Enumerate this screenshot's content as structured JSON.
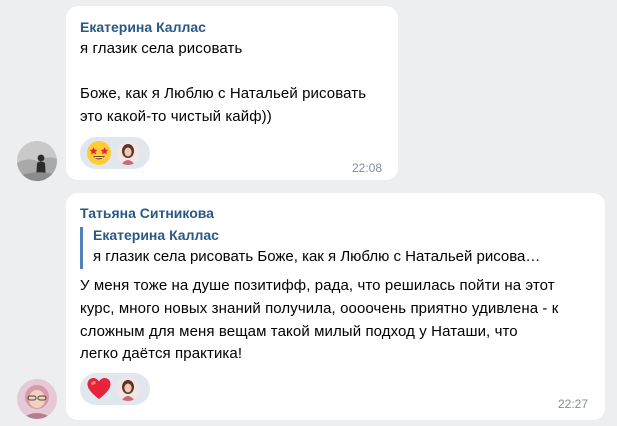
{
  "messages": [
    {
      "author": "Екатерина Каллас",
      "lines": [
        "я глазик села рисовать",
        "",
        "Боже, как я Люблю с Натальей рисовать",
        "это какой-то чистый кайф))"
      ],
      "reaction": "star-struck-emoji",
      "time": "22:08"
    },
    {
      "author": "Татьяна Ситникова",
      "reply": {
        "author": "Екатерина Каллас",
        "text": "я глазик села рисовать Боже, как я Люблю с Натальей рисова…"
      },
      "lines": [
        "У меня тоже на душе позитифф, рада, что решилась пойти на этот",
        "курс, много новых знаний получила, оооочень приятно удивлена - к",
        "сложным для меня вещам такой милый подход у Наташи, что",
        "легко даётся практика!"
      ],
      "reaction": "red-heart-emoji",
      "time": "22:27"
    }
  ],
  "colors": {
    "background": "#edeef0",
    "bubble": "#ffffff",
    "author": "#2a5885",
    "quote_bar": "#5181b8",
    "time": "#818c99",
    "reaction_bg": "#e1e7ef"
  }
}
